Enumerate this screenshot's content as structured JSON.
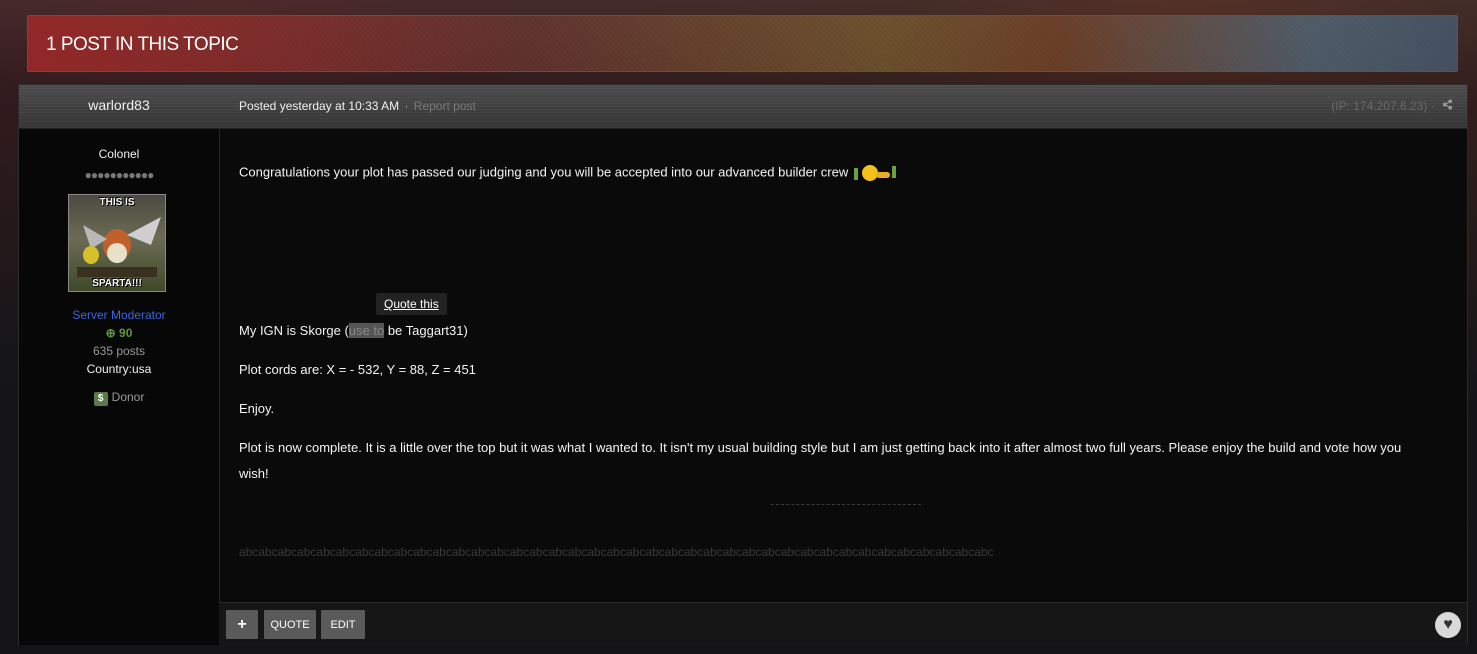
{
  "topic": {
    "title": "1 POST IN THIS TOPIC"
  },
  "post": {
    "author": "warlord83",
    "posted_label": "Posted yesterday at 10:33 AM",
    "separator": "·",
    "report_label": "Report post",
    "ip_label": "(IP: 174.207.6.23)",
    "share_icon": "share-icon"
  },
  "author_info": {
    "rank": "Colonel",
    "pips": "●●●●●●●●●●●",
    "avatar_top_text": "THIS IS",
    "avatar_bottom_text": "SPARTA!!!",
    "group": "Server Moderator",
    "reputation": "90",
    "post_count": "635 posts",
    "country": "Country:usa",
    "donor_badge": "$",
    "donor_label": "Donor"
  },
  "content": {
    "line1": "Congratulations your plot has passed our judging  and you will be accepted into our advanced  builder crew",
    "tooltip": "Quote this",
    "ign_before": "My IGN is Skorge (",
    "ign_highlight": "use to",
    "ign_after": " be Taggart31)",
    "cords": "Plot cords are: X = - 532, Y = 88, Z = 451",
    "enjoy": "Enjoy.",
    "complete_1": "Plot is now complete. It is a little over the top but it was what I wanted to. It isn't my usual building style but I am just getting back into it after almost two full years. Please enjoy the build and vote how you",
    "complete_2": "wish!",
    "signature": "abcabcabcabcabcabcabcabcabcabcabcabcabcabcabcabcabcabcabcabcabcabcabcabcabcabcabcabcabcabcabcabcabcabcabcabcabcabcabc"
  },
  "controls": {
    "plus_label": "+",
    "quote_label": "QUOTE",
    "edit_label": "EDIT",
    "like_icon": "heart-icon"
  }
}
